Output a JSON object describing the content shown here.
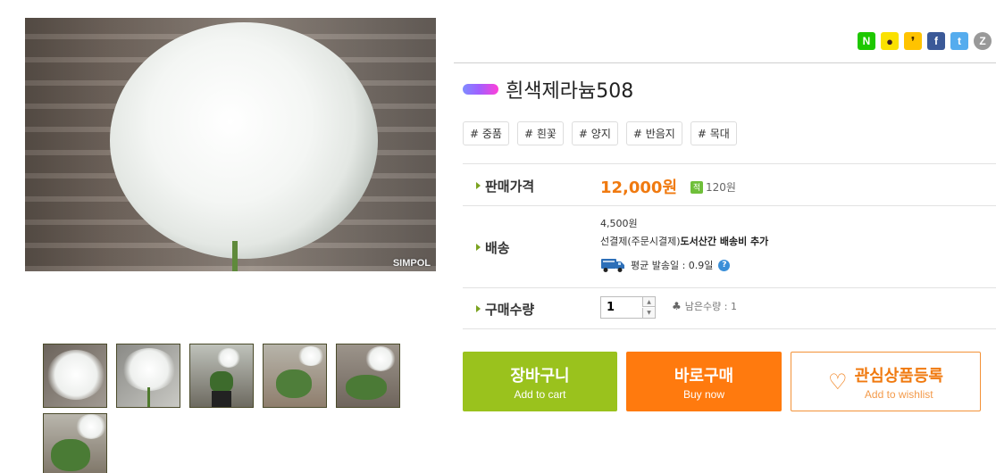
{
  "product": {
    "title": "흰색제라늄508",
    "image_watermark": "SIMPOL",
    "thumbnail_count": 6
  },
  "share": [
    {
      "icon": "naver-icon",
      "glyph": "N",
      "color": "#1ec800"
    },
    {
      "icon": "kakaotalk-icon",
      "glyph": "●",
      "color": "#fae100"
    },
    {
      "icon": "kakaostory-icon",
      "glyph": "❜",
      "color": "#ffc300"
    },
    {
      "icon": "facebook-icon",
      "glyph": "f",
      "color": "#3b5998"
    },
    {
      "icon": "twitter-icon",
      "glyph": "t",
      "color": "#55acee"
    },
    {
      "icon": "band-icon",
      "glyph": "Z",
      "color": "#999999"
    }
  ],
  "tags": [
    "# 중품",
    "# 흰꽃",
    "# 양지",
    "# 반음지",
    "# 목대"
  ],
  "price": {
    "label": "판매가격",
    "value": "12,000원",
    "point_icon": "적",
    "point": "120원"
  },
  "shipping": {
    "label": "배송",
    "fee": "4,500원",
    "method_prefix": "선결제(주문시결제)",
    "method_suffix": "도서산간 배송비 추가",
    "average_text": "평균 발송일 : 0.9일",
    "help_glyph": "?"
  },
  "quantity": {
    "label": "구매수량",
    "value": "1",
    "up_glyph": "▲",
    "down_glyph": "▼",
    "stock_icon": "♣",
    "stock_text": "남은수량 : 1"
  },
  "buttons": {
    "cart_label": "장바구니",
    "cart_sub": "Add to cart",
    "buy_label": "바로구매",
    "buy_sub": "Buy now",
    "wish_icon": "♡",
    "wish_label": "관심상품등록",
    "wish_sub": "Add to wishlist"
  },
  "colors": {
    "accent_green": "#9ac21d",
    "accent_orange": "#ff7a0e",
    "price_orange": "#f07a10"
  }
}
